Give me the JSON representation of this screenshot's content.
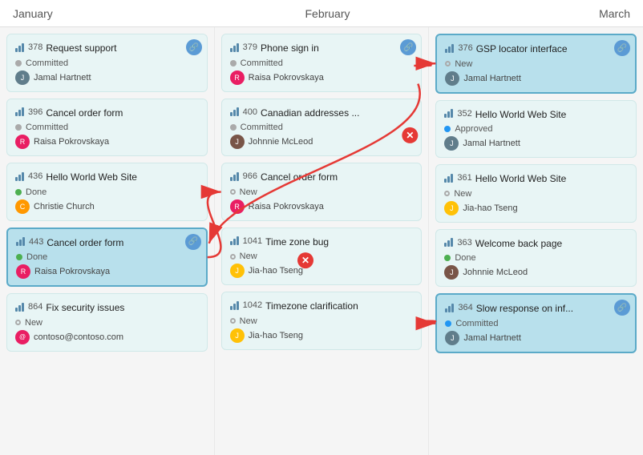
{
  "columns": [
    {
      "name": "January",
      "cards": [
        {
          "id": "378",
          "title": "Request support",
          "status": "Committed",
          "statusType": "committed",
          "user": "Jamal Hartnett",
          "userType": "jamal",
          "hasLink": true,
          "highlight": false
        },
        {
          "id": "396",
          "title": "Cancel order form",
          "status": "Committed",
          "statusType": "committed",
          "user": "Raisa Pokrovskaya",
          "userType": "raisa",
          "hasLink": false,
          "highlight": false
        },
        {
          "id": "436",
          "title": "Hello World Web Site",
          "status": "Done",
          "statusType": "done",
          "user": "Christie Church",
          "userType": "christie",
          "hasLink": false,
          "highlight": false
        },
        {
          "id": "443",
          "title": "Cancel order form",
          "status": "Done",
          "statusType": "done",
          "user": "Raisa Pokrovskaya",
          "userType": "raisa",
          "hasLink": true,
          "highlight": true,
          "selected": true
        },
        {
          "id": "864",
          "title": "Fix security issues",
          "status": "New",
          "statusType": "new",
          "user": "contoso@contoso.com",
          "userType": "contoso",
          "hasLink": false,
          "highlight": false
        }
      ]
    },
    {
      "name": "February",
      "cards": [
        {
          "id": "379",
          "title": "Phone sign in",
          "status": "Committed",
          "statusType": "committed",
          "user": "Raisa Pokrovskaya",
          "userType": "raisa",
          "hasLink": true,
          "highlight": false
        },
        {
          "id": "400",
          "title": "Canadian addresses ...",
          "status": "Committed",
          "statusType": "committed",
          "user": "Johnnie McLeod",
          "userType": "johnnie",
          "hasLink": false,
          "highlight": false
        },
        {
          "id": "966",
          "title": "Cancel order form",
          "status": "New",
          "statusType": "new",
          "user": "Raisa Pokrovskaya",
          "userType": "raisa",
          "hasLink": false,
          "highlight": false
        },
        {
          "id": "1041",
          "title": "Time zone bug",
          "status": "New",
          "statusType": "new",
          "user": "Jia-hao Tseng",
          "userType": "jia",
          "hasLink": false,
          "highlight": false
        },
        {
          "id": "1042",
          "title": "Timezone clarification",
          "status": "New",
          "statusType": "new",
          "user": "Jia-hao Tseng",
          "userType": "jia",
          "hasLink": false,
          "highlight": false
        }
      ]
    },
    {
      "name": "March",
      "cards": [
        {
          "id": "376",
          "title": "GSP locator interface",
          "status": "New",
          "statusType": "new",
          "user": "Jamal Hartnett",
          "userType": "jamal",
          "hasLink": true,
          "highlight": false,
          "selected": true
        },
        {
          "id": "352",
          "title": "Hello World Web Site",
          "status": "Approved",
          "statusType": "approved",
          "user": "Jamal Hartnett",
          "userType": "jamal",
          "hasLink": false,
          "highlight": false
        },
        {
          "id": "361",
          "title": "Hello World Web Site",
          "status": "New",
          "statusType": "new",
          "user": "Jia-hao Tseng",
          "userType": "jia",
          "hasLink": false,
          "highlight": false
        },
        {
          "id": "363",
          "title": "Welcome back page",
          "status": "Done",
          "statusType": "done",
          "user": "Johnnie McLeod",
          "userType": "johnnie",
          "hasLink": false,
          "highlight": false
        },
        {
          "id": "364",
          "title": "Slow response on inf...",
          "status": "Committed",
          "statusType": "committed-blue",
          "user": "Jamal Hartnett",
          "userType": "jamal",
          "hasLink": true,
          "highlight": false,
          "selected": true
        }
      ]
    }
  ],
  "headers": {
    "january": "January",
    "february": "February",
    "march": "March"
  }
}
